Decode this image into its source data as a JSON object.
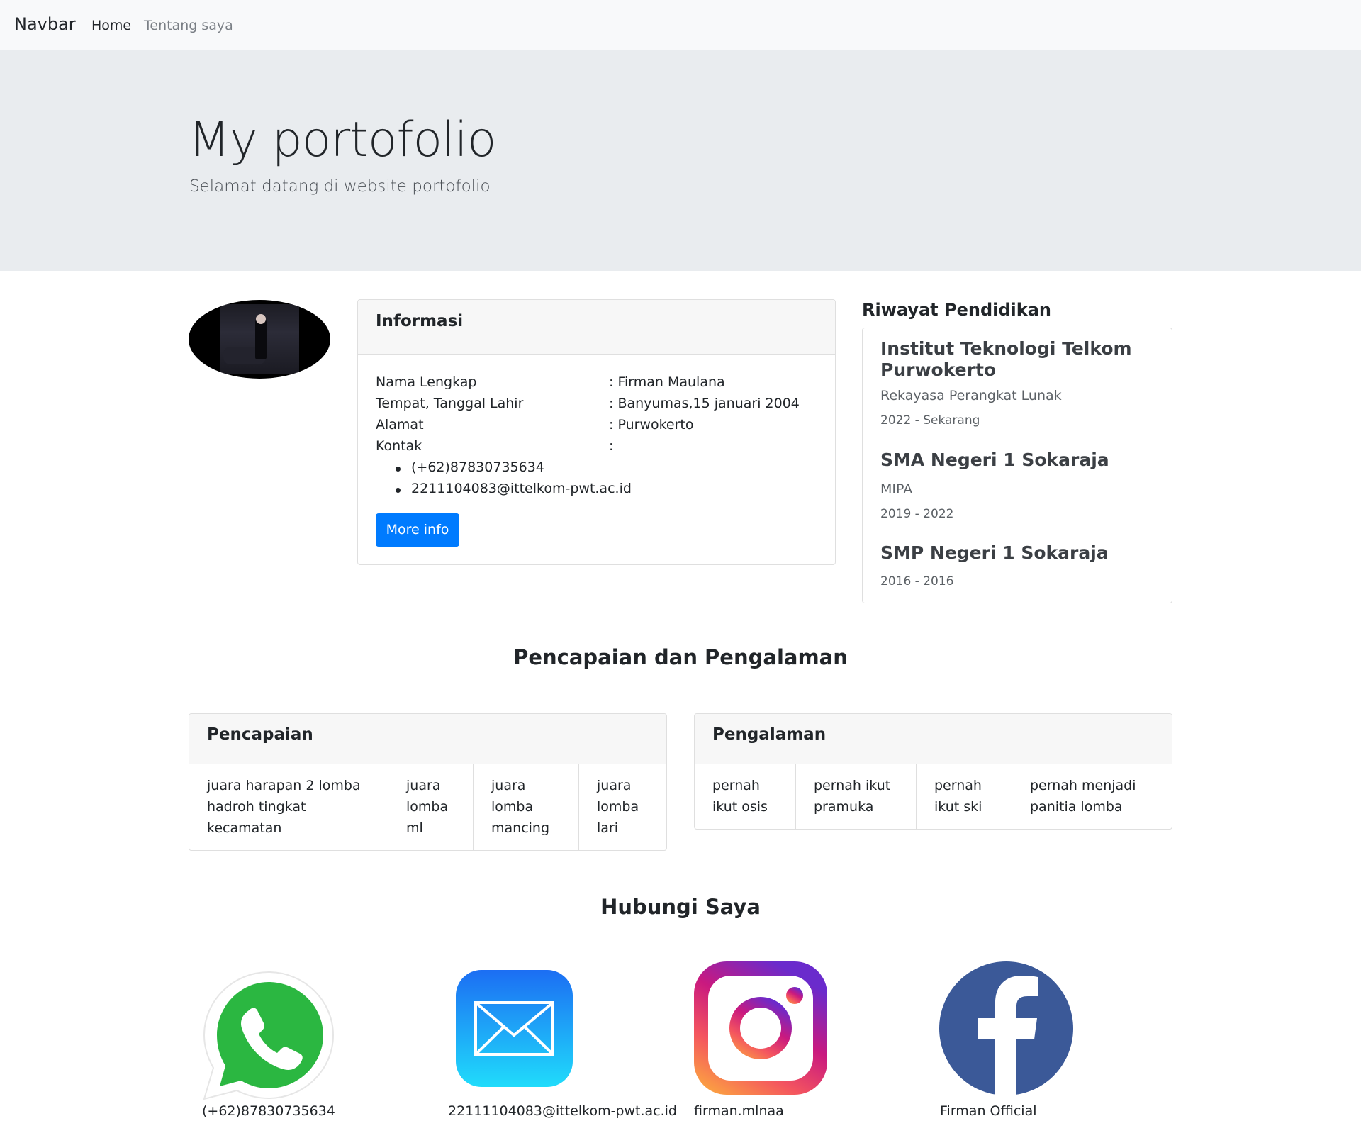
{
  "navbar": {
    "brand": "Navbar",
    "items": [
      {
        "label": "Home"
      },
      {
        "label": "Tentang saya"
      }
    ]
  },
  "jumbotron": {
    "title": "My portofolio",
    "subtitle": "Selamat datang di website portofolio"
  },
  "info": {
    "title": "Informasi",
    "rows": [
      {
        "label": "Nama Lengkap",
        "value": ": Firman Maulana"
      },
      {
        "label": "Tempat, Tanggal Lahir",
        "value": ": Banyumas,15 januari 2004"
      },
      {
        "label": "Alamat",
        "value": ": Purwokerto"
      },
      {
        "label": "Kontak",
        "value": ":"
      }
    ],
    "contacts": [
      "(+62)87830735634",
      "2211104083@ittelkom-pwt.ac.id"
    ],
    "button": "More info"
  },
  "education": {
    "title": "Riwayat Pendidikan",
    "items": [
      {
        "name": "Institut Teknologi Telkom Purwokerto",
        "major": "Rekayasa Perangkat Lunak",
        "years": "2022 - Sekarang"
      },
      {
        "name": "SMA Negeri 1 Sokaraja",
        "major": "MIPA",
        "years": "2019 - 2022"
      },
      {
        "name": "SMP Negeri 1 Sokaraja",
        "years": "2016 - 2016"
      }
    ]
  },
  "achievements_section": {
    "title": "Pencapaian dan Pengalaman",
    "achievements": {
      "title": "Pencapaian",
      "items": [
        "juara harapan 2 lomba hadroh tingkat kecamatan",
        "juara lomba ml",
        "juara lomba mancing",
        "juara lomba lari"
      ]
    },
    "experience": {
      "title": "Pengalaman",
      "items": [
        "pernah ikut osis",
        "pernah ikut pramuka",
        "pernah ikut ski",
        "pernah menjadi panitia lomba"
      ]
    }
  },
  "contact_section": {
    "title": "Hubungi Saya",
    "items": [
      {
        "icon": "whatsapp-icon",
        "label": "(+62)87830735634"
      },
      {
        "icon": "mail-icon",
        "label": "22111104083@ittelkom-pwt.ac.id"
      },
      {
        "icon": "instagram-icon",
        "label": "firman.mlnaa"
      },
      {
        "icon": "facebook-icon",
        "label": "Firman Official"
      }
    ]
  },
  "colors": {
    "primary": "#007bff",
    "navbar_bg": "#f8f9fa",
    "jumbotron_bg": "#e9ecef",
    "whatsapp": "#2bb741",
    "facebook": "#3b5998"
  }
}
